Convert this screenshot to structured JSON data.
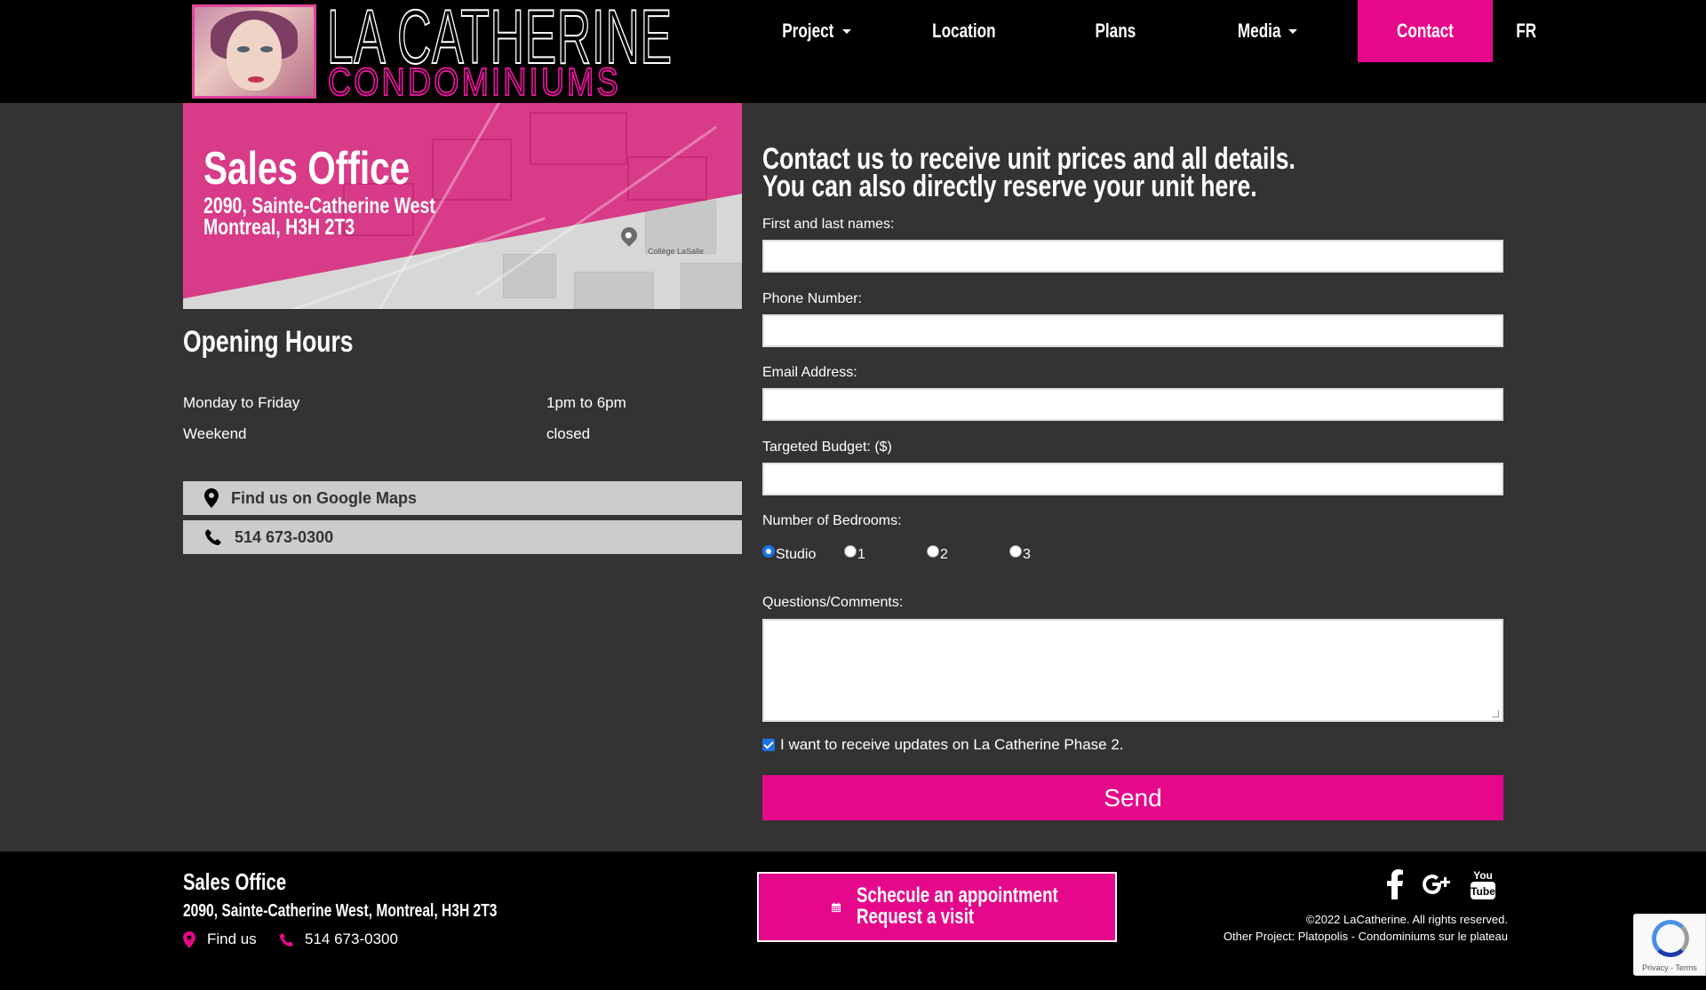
{
  "brand": {
    "title_line1": "LA CATHERINE",
    "title_line2": "CONDOMINIUMS",
    "accent_color": "#e6088a",
    "background": "#333333"
  },
  "nav": {
    "items": [
      {
        "label": "Project",
        "dropdown": true
      },
      {
        "label": "Location",
        "dropdown": false
      },
      {
        "label": "Plans",
        "dropdown": false
      },
      {
        "label": "Media",
        "dropdown": true
      },
      {
        "label": "Contact",
        "dropdown": false,
        "active": true
      }
    ],
    "lang": "FR"
  },
  "sales": {
    "title": "Sales Office",
    "address_line1": "2090, Sainte-Catherine West",
    "address_line2": "Montreal, H3H 2T3",
    "map_place": "Collège LaSalle"
  },
  "hours": {
    "title": "Opening Hours",
    "rows": [
      {
        "day": "Monday to Friday",
        "time": "1pm to 6pm"
      },
      {
        "day": "Weekend",
        "time": "closed"
      }
    ]
  },
  "side_buttons": {
    "maps": "Find us on Google Maps",
    "phone": "514 673-0300"
  },
  "form": {
    "heading_line1": "Contact us to receive unit prices and all details.",
    "heading_line2": "You can also directly reserve your unit here.",
    "name_label": "First and last names:",
    "phone_label": "Phone Number:",
    "email_label": "Email Address:",
    "budget_label": "Targeted Budget: ($)",
    "bedrooms_label": "Number of Bedrooms:",
    "bedroom_options": [
      "Studio",
      "1",
      "2",
      "3"
    ],
    "bedroom_selected": "Studio",
    "comments_label": "Questions/Comments:",
    "updates_label": "I want to receive updates on La Catherine Phase 2.",
    "updates_checked": true,
    "send_label": "Send"
  },
  "footer": {
    "title": "Sales Office",
    "address": "2090, Sainte-Catherine West, Montreal, H3H 2T3",
    "find_us": "Find us",
    "phone": "514 673-0300",
    "schedule_line1": "Schecule an appointment",
    "schedule_line2": "Request a visit",
    "social_icons": [
      "facebook-icon",
      "google-plus-icon",
      "youtube-icon"
    ],
    "youtube_text1": "You",
    "youtube_text2": "Tube",
    "copyright": "©2022 LaCatherine. All rights reserved.",
    "other_project": "Other Project:  Platopolis - Condominiums sur le plateau"
  },
  "recaptcha": {
    "terms": "Privacy - Terms"
  }
}
